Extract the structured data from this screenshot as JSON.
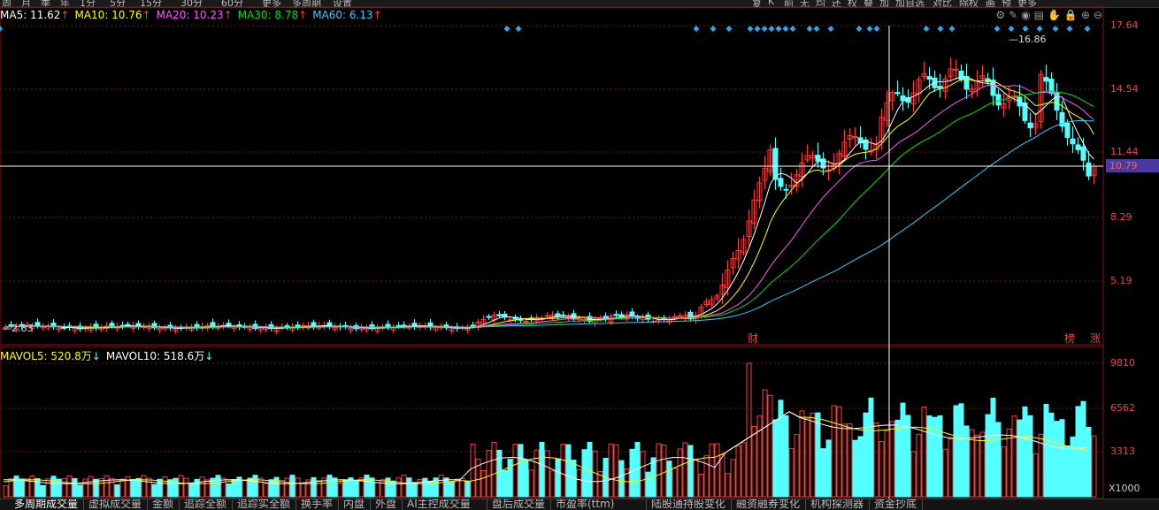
{
  "top_toolbar": {
    "left_items": [
      "周",
      "月",
      "季",
      "年",
      "1分",
      "5分",
      "15分",
      "30分",
      "60分",
      "更多",
      "多周期",
      "设置"
    ],
    "right_items": [
      "复",
      "K",
      "前",
      "无",
      "均",
      "还",
      "权",
      "叠",
      "加",
      "加自选",
      "对比",
      "除权",
      "画",
      "预",
      "更多"
    ]
  },
  "ma_legend": [
    {
      "label": "MA5: 11.62",
      "arrow": "↑",
      "color": "#ffffff"
    },
    {
      "label": "MA10: 10.76",
      "arrow": "↑",
      "color": "#ffff00"
    },
    {
      "label": "MA20: 10.23",
      "arrow": "↑",
      "color": "#ff55ff"
    },
    {
      "label": "MA30: 8.78",
      "arrow": "↑",
      "color": "#00e000"
    },
    {
      "label": "MA60: 6.13",
      "arrow": "↑",
      "color": "#33ccff"
    }
  ],
  "vol_legend": [
    {
      "label": "MAVOL5: 520.8万",
      "arrow": "↓",
      "color": "#ffff00"
    },
    {
      "label": "MAVOL10: 518.6万",
      "arrow": "↓",
      "color": "#ffffff"
    }
  ],
  "tool_icons": [
    "settings-icon",
    "edit-icon",
    "eye-icon",
    "save-icon",
    "hand-icon",
    "lock-icon",
    "zoom-in-icon",
    "zoom-out-icon"
  ],
  "tool_glyphs": [
    "⚙",
    "✎",
    "◉",
    "▤",
    "✋",
    "🔒",
    "⊕",
    "⊖"
  ],
  "price_axis": [
    "17.64",
    "14.54",
    "11.44",
    "8.29",
    "5.19"
  ],
  "current_price": "10.79",
  "max_label": "16.86",
  "min_label": "2.83",
  "volume_axis": [
    "9810",
    "6562",
    "3313"
  ],
  "volume_unit": "X1000",
  "event_marks": {
    "fin": "财",
    "rank": "榜",
    "up": "涨"
  },
  "bottom_tabs": [
    "多周期成交量",
    "虚拟成交量",
    "金额",
    "追踪全额",
    "追踪实全额",
    "换手率",
    "内盘",
    "外盘",
    "AI主控成交量",
    "盘后成交量",
    "市盈率(ttm)",
    "陆股通持股变化",
    "融资融券变化",
    "机构探测器",
    "资金抄底"
  ],
  "colors": {
    "up": "#ff3a3a",
    "down": "#54ffff",
    "ma5": "#ffffff",
    "ma10": "#ffff00",
    "ma20": "#ff55ff",
    "ma30": "#00e000",
    "ma60": "#33ccff",
    "grid": "#7a1010"
  }
}
